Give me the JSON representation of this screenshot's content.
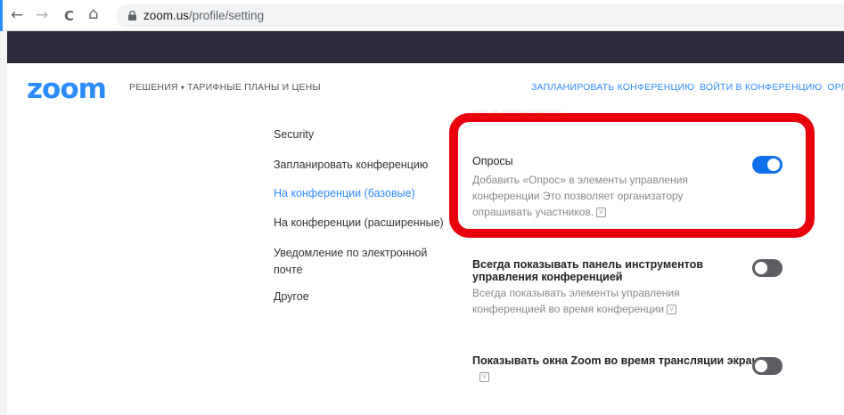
{
  "browser": {
    "back": "←",
    "forward": "→",
    "reload": "C",
    "home": "⌂",
    "url_host": "zoom.us",
    "url_path": "/profile/setting"
  },
  "header": {
    "logo": "zoom",
    "menu": [
      "РЕШЕНИЯ",
      "ТАРИФНЫЕ ПЛАНЫ И ЦЕНЫ"
    ],
    "menu_caret": "▾",
    "nav": [
      "ЗАПЛАНИРОВАТЬ КОНФЕРЕНЦИЮ",
      "ВОЙТИ В КОНФЕРЕНЦИЮ",
      "ОРГ"
    ]
  },
  "faded_text": [
    "что и организатор."
  ],
  "sidebar": {
    "items": [
      {
        "label": "Security"
      },
      {
        "label": "Запланировать конференцию"
      },
      {
        "label": "На конференции (базовые)",
        "active": true
      },
      {
        "label": "На конференции (расширенные)"
      },
      {
        "label": "Уведомление по электронной почте"
      },
      {
        "label": "Другое"
      }
    ]
  },
  "settings": [
    {
      "title": "Опросы",
      "desc_lines": [
        "Добавить «Опрос» в элементы управления",
        "конференции Это позволяет организатору",
        "опрашивать участников."
      ],
      "enabled": true
    },
    {
      "title_lines": [
        "Всегда показывать панель инструментов",
        "управления конференцией"
      ],
      "desc_lines": [
        "Всегда показывать элементы управления",
        "конференцией во время конференции"
      ],
      "enabled": false
    },
    {
      "title_lines": [
        "Показывать окна Zoom во время трансляции экрана"
      ],
      "desc_lines": [],
      "enabled": false
    }
  ],
  "info_icon_glyph": "V",
  "colors": {
    "brand": "#2d8cff",
    "toggle_on": "#0e71eb",
    "toggle_off": "#5d5d64",
    "highlight": "#e8000d",
    "dark_band": "#2c2c3e"
  }
}
